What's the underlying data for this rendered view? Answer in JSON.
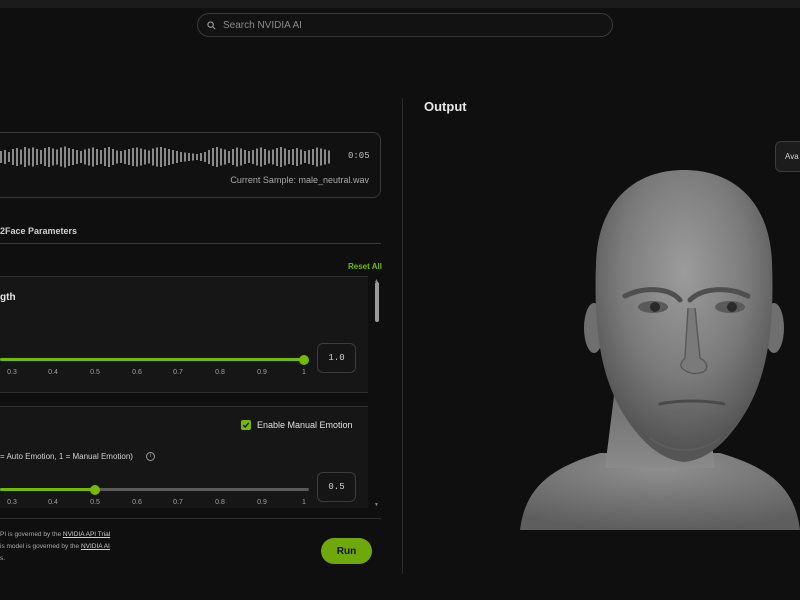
{
  "search": {
    "placeholder": "Search NVIDIA AI",
    "icon": "search-icon"
  },
  "audio": {
    "duration": "0:05",
    "current_sample": "Current Sample: male_neutral.wav"
  },
  "params": {
    "section_label": "2Face Parameters",
    "reset_label": "Reset All",
    "cards": [
      {
        "title": "gth",
        "value": "1.0",
        "level": 1.0,
        "ticks": [
          "0.3",
          "0.4",
          "0.5",
          "0.6",
          "0.7",
          "0.8",
          "0.9",
          "1"
        ]
      },
      {
        "checkbox_label": "Enable Manual Emotion",
        "checkbox_checked": true,
        "label": "= Auto Emotion, 1 = Manual Emotion)",
        "value": "0.5",
        "level": 0.5,
        "ticks": [
          "0.3",
          "0.4",
          "0.5",
          "0.6",
          "0.7",
          "0.8",
          "0.9",
          "1"
        ]
      }
    ]
  },
  "footer": {
    "line1_prefix": "PI is governed by the ",
    "line1_link": "NVIDIA API Trial",
    "line2_prefix": "is model is governed by the ",
    "line2_link": "NVIDIA AI",
    "line3": "s."
  },
  "run_label": "Run",
  "output": {
    "title": "Output",
    "avail_label": "Ava"
  },
  "colors": {
    "accent": "#76b900",
    "background": "#0f0f0f"
  }
}
